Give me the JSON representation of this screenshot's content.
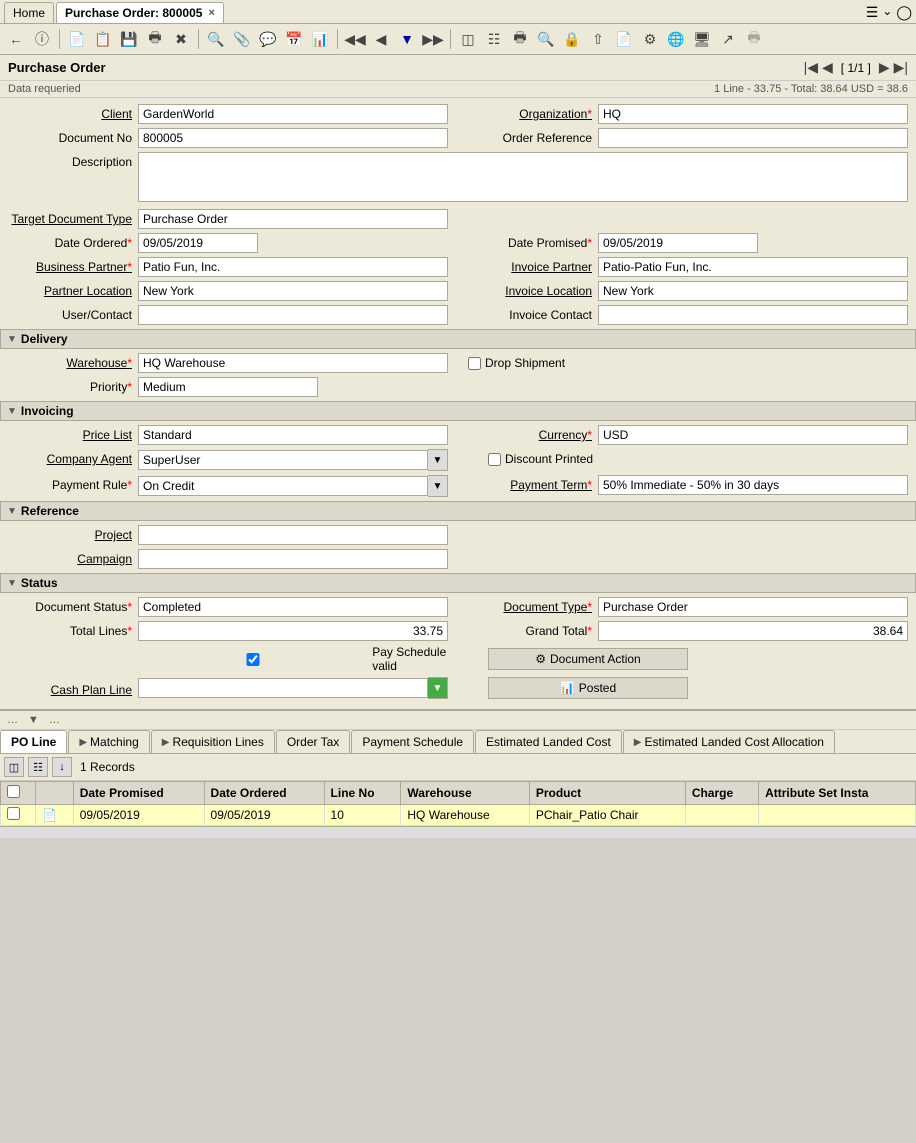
{
  "tabs": {
    "home": "Home",
    "purchase_order": "Purchase Order: 800005",
    "close_icon": "×"
  },
  "toolbar": {
    "buttons": [
      "↩",
      "?",
      "📄",
      "📋",
      "🖫",
      "🖨",
      "✂",
      "📎",
      "💬",
      "📅",
      "📊",
      "◀",
      "▶",
      "⊞",
      "⊟",
      "🔍",
      "📎",
      "▶▶",
      "◀◀",
      "🖫",
      "📤",
      "🖨",
      "🔍",
      "🔒",
      "⬆",
      "📋",
      "⚙",
      "🌐",
      "🖥",
      "↗"
    ]
  },
  "page": {
    "title": "Purchase Order",
    "nav_label": "[ 1/1 ]",
    "data_requeried": "Data requeried",
    "summary": "1 Line - 33.75 - Total: 38.64 USD = 38.6"
  },
  "form": {
    "client_label": "Client",
    "client_value": "GardenWorld",
    "organization_label": "Organization",
    "organization_value": "HQ",
    "document_no_label": "Document No",
    "document_no_value": "800005",
    "order_reference_label": "Order Reference",
    "order_reference_value": "",
    "description_label": "Description",
    "description_value": "",
    "target_document_type_label": "Target Document Type",
    "target_document_type_value": "Purchase Order",
    "date_ordered_label": "Date Ordered",
    "date_ordered_value": "09/05/2019",
    "date_promised_label": "Date Promised",
    "date_promised_value": "09/05/2019",
    "business_partner_label": "Business Partner",
    "business_partner_value": "Patio Fun, Inc.",
    "invoice_partner_label": "Invoice Partner",
    "invoice_partner_value": "Patio-Patio Fun, Inc.",
    "partner_location_label": "Partner Location",
    "partner_location_value": "New York",
    "invoice_location_label": "Invoice Location",
    "invoice_location_value": "New York",
    "user_contact_label": "User/Contact",
    "user_contact_value": "",
    "invoice_contact_label": "Invoice Contact",
    "invoice_contact_value": "",
    "delivery_section": "Delivery",
    "warehouse_label": "Warehouse",
    "warehouse_value": "HQ Warehouse",
    "drop_shipment_label": "Drop Shipment",
    "drop_shipment_checked": false,
    "priority_label": "Priority",
    "priority_value": "Medium",
    "invoicing_section": "Invoicing",
    "price_list_label": "Price List",
    "price_list_value": "Standard",
    "currency_label": "Currency",
    "currency_value": "USD",
    "company_agent_label": "Company Agent",
    "company_agent_value": "SuperUser",
    "discount_printed_label": "Discount Printed",
    "discount_printed_checked": false,
    "payment_rule_label": "Payment Rule",
    "payment_rule_value": "On Credit",
    "payment_term_label": "Payment Term",
    "payment_term_value": "50% Immediate - 50% in 30 days",
    "reference_section": "Reference",
    "project_label": "Project",
    "project_value": "",
    "campaign_label": "Campaign",
    "campaign_value": "",
    "status_section": "Status",
    "document_status_label": "Document Status",
    "document_status_value": "Completed",
    "document_type_label": "Document Type",
    "document_type_value": "Purchase Order",
    "total_lines_label": "Total Lines",
    "total_lines_value": "33.75",
    "grand_total_label": "Grand Total",
    "grand_total_value": "38.64",
    "pay_schedule_label": "Pay Schedule valid",
    "pay_schedule_checked": true,
    "document_action_btn": "Document Action",
    "cash_plan_line_label": "Cash Plan Line",
    "cash_plan_line_value": "",
    "posted_btn": "Posted"
  },
  "bottom_tabs": {
    "po_line": "PO Line",
    "matching": "Matching",
    "requisition_lines": "Requisition Lines",
    "order_tax": "Order Tax",
    "payment_schedule": "Payment Schedule",
    "estimated_landed_cost": "Estimated Landed Cost",
    "estimated_landed_cost_allocation": "Estimated Landed Cost Allocation"
  },
  "table": {
    "records": "1 Records",
    "columns": [
      "",
      "",
      "Date Promised",
      "Date Ordered",
      "Line No",
      "Warehouse",
      "Product",
      "Charge",
      "Attribute Set Insta"
    ],
    "rows": [
      {
        "check": false,
        "icon": "📄",
        "date_promised": "09/05/2019",
        "date_ordered": "09/05/2019",
        "line_no": "10",
        "warehouse": "HQ Warehouse",
        "product": "PChair_Patio Chair",
        "charge": "",
        "attribute_set": ""
      }
    ]
  }
}
